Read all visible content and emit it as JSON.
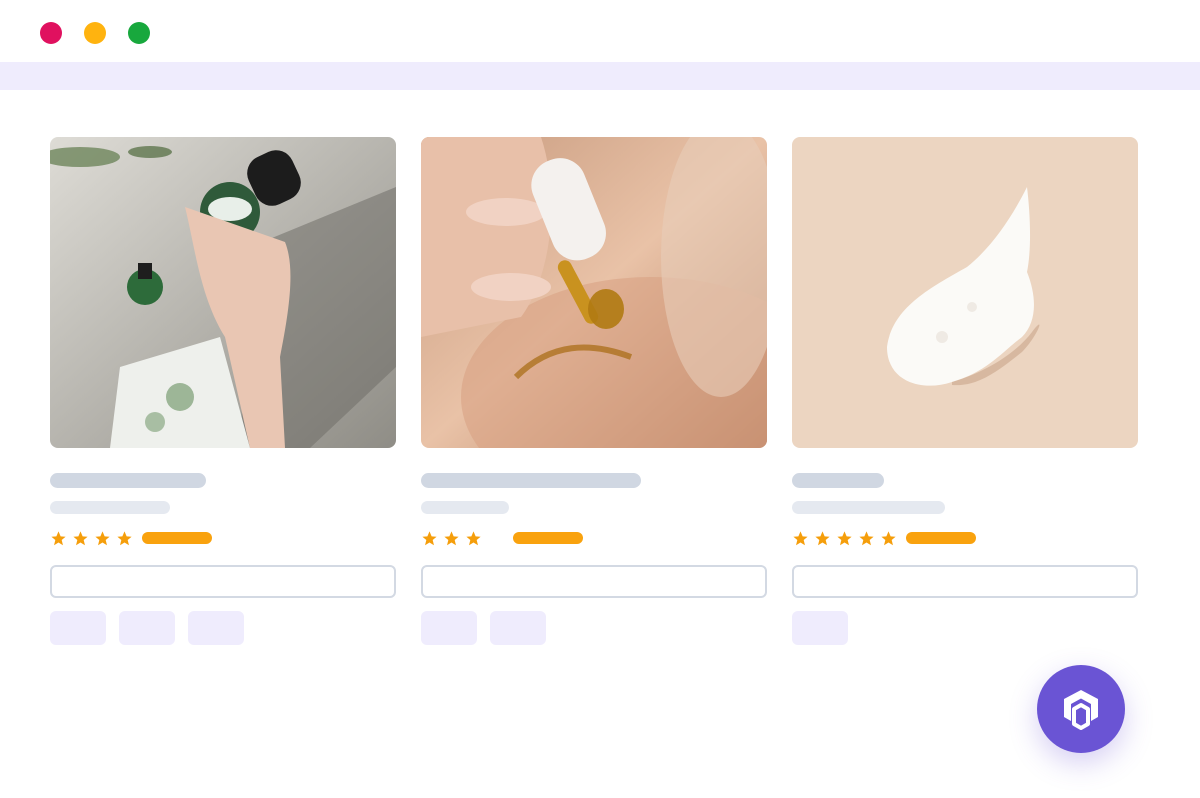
{
  "window": {
    "controls": [
      {
        "name": "close",
        "color": "#e0115f"
      },
      {
        "name": "minimize",
        "color": "#ffb30f"
      },
      {
        "name": "maximize",
        "color": "#18a83d"
      }
    ],
    "addressbar_color": "#efecfd"
  },
  "products": [
    {
      "image": "skincare-jars-and-sheet-mask-photo",
      "rating": 4,
      "title_placeholder_width": 156,
      "subtitle_placeholder_width": 120,
      "option_chips": 3
    },
    {
      "image": "serum-dropper-on-skin-photo",
      "rating": 3,
      "title_placeholder_width": 220,
      "subtitle_placeholder_width": 88,
      "option_chips": 2
    },
    {
      "image": "cream-swatch-photo",
      "rating": 5,
      "title_placeholder_width": 92,
      "subtitle_placeholder_width": 153,
      "option_chips": 1
    }
  ],
  "colors": {
    "star": "#f59e0b",
    "price_bar": "#f9a20e",
    "placeholder_bar": "#d0d7e2",
    "chip": "#efecfd",
    "fab": "#6a54d4"
  },
  "fab": {
    "icon": "cube-logo-icon"
  }
}
